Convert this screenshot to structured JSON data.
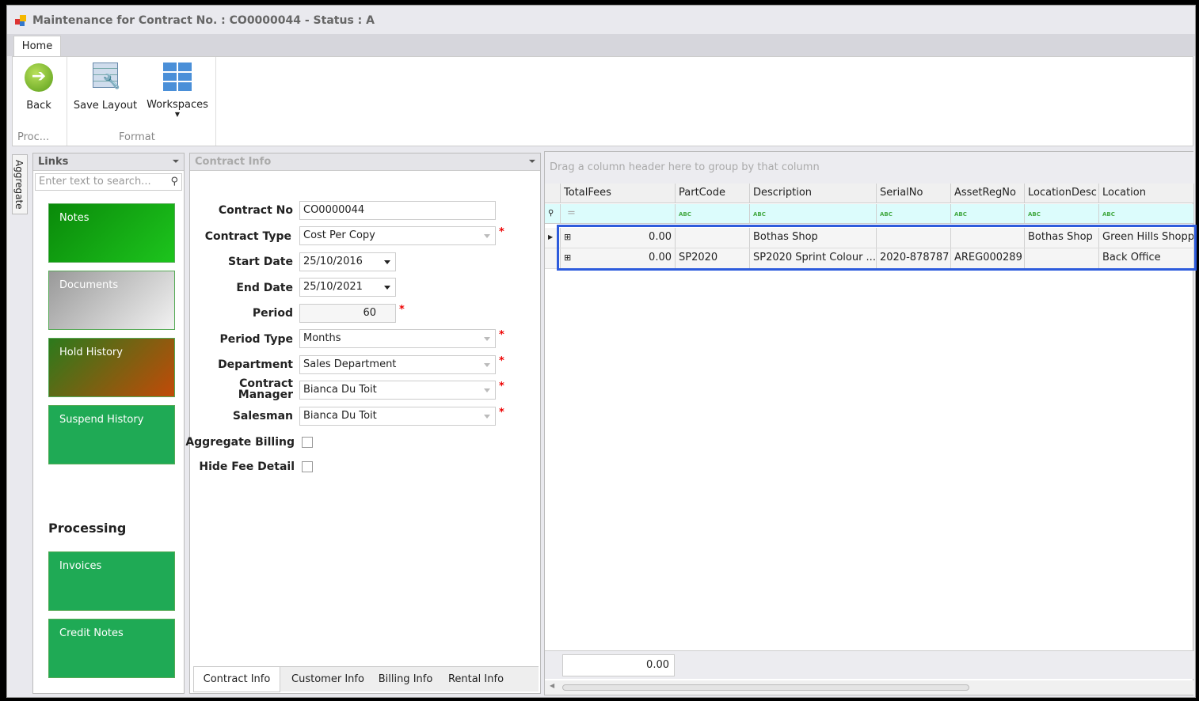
{
  "window": {
    "title": "Maintenance for Contract No. : CO0000044 - Status : A"
  },
  "ribbon": {
    "tab": "Home",
    "back": "Back",
    "save_layout": "Save Layout",
    "workspaces": "Workspaces",
    "group_proc": "Proc...",
    "group_format": "Format"
  },
  "side_tab": "Aggregate",
  "links": {
    "title": "Links",
    "search_placeholder": "Enter text to search...",
    "tiles": [
      {
        "label": "Notes",
        "color": "#16b316"
      },
      {
        "label": "Documents",
        "color": "#b8b8b8"
      },
      {
        "label": "Hold History",
        "color": "#b44a10"
      },
      {
        "label": "Suspend History",
        "color": "#1faa55"
      }
    ],
    "processing_label": "Processing",
    "processing_tiles": [
      {
        "label": "Invoices",
        "color": "#1faa55"
      },
      {
        "label": "Credit Notes",
        "color": "#1faa55"
      }
    ]
  },
  "contract": {
    "title": "Contract Info",
    "contract_no_label": "Contract No",
    "contract_no": "CO0000044",
    "contract_type_label": "Contract Type",
    "contract_type": "Cost Per Copy",
    "start_date_label": "Start Date",
    "start_date": "25/10/2016",
    "end_date_label": "End Date",
    "end_date": "25/10/2021",
    "period_label": "Period",
    "period": "60",
    "period_type_label": "Period Type",
    "period_type": "Months",
    "department_label": "Department",
    "department": "Sales Department",
    "manager_label_1": "Contract",
    "manager_label_2": "Manager",
    "manager": "Bianca Du Toit",
    "salesman_label": "Salesman",
    "salesman": "Bianca Du Toit",
    "aggregate_label": "Aggregate Billing",
    "aggregate_checked": false,
    "hide_fee_label": "Hide Fee Detail",
    "hide_fee_checked": false,
    "required": "*",
    "tabs": [
      "Contract Info",
      "Customer Info",
      "Billing Info",
      "Rental Info"
    ]
  },
  "grid": {
    "group_hint": "Drag a column header here to group by that column",
    "columns": [
      "TotalFees",
      "PartCode",
      "Description",
      "SerialNo",
      "AssetRegNo",
      "LocationDesc",
      "Location"
    ],
    "filter_eq": "=",
    "filter_abc": "ABC",
    "rows": [
      [
        "0.00",
        "",
        "Bothas Shop",
        "",
        "",
        "Bothas Shop",
        "Green Hills Shoppin"
      ],
      [
        "0.00",
        "SP2020",
        "SP2020 Sprint Colour ...",
        "2020-878787",
        "AREG000289",
        "",
        "Back Office"
      ]
    ],
    "total": "0.00",
    "highlight_color": "#2d5bdc"
  }
}
